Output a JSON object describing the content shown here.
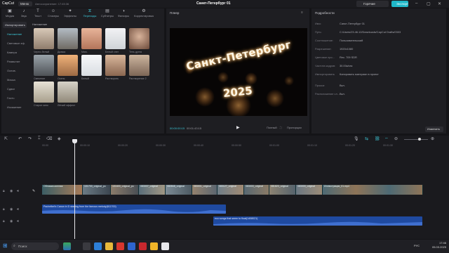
{
  "titlebar": {
    "app_name": "CapCut",
    "menu_label": "Меню",
    "autosave": "Автосохранение: 17:45:36",
    "project_title": "Санкт-Петербург 01",
    "hotkeys_label": "Горячие клавиши",
    "export_label": "Экспорт"
  },
  "toolbar": {
    "tools": [
      {
        "label": "Медиа",
        "icon": "media-icon",
        "active": false
      },
      {
        "label": "Звук",
        "icon": "audio-icon",
        "active": false
      },
      {
        "label": "Текст",
        "icon": "text-icon",
        "active": false
      },
      {
        "label": "Стикеры",
        "icon": "sticker-icon",
        "active": false
      },
      {
        "label": "Эффекты",
        "icon": "effects-icon",
        "active": false
      },
      {
        "label": "Переходы",
        "icon": "transitions-icon",
        "active": true
      },
      {
        "label": "Субтитры",
        "icon": "subtitles-icon",
        "active": false
      },
      {
        "label": "Фильтры",
        "icon": "filters-icon",
        "active": false
      },
      {
        "label": "Корректировка",
        "icon": "adjust-icon",
        "active": false
      }
    ]
  },
  "media": {
    "import_label": "Импортировать",
    "section_label": "Наложение",
    "categories": [
      "Наложение",
      "Световые эф.",
      "Камера",
      "Размытие",
      "Основ.",
      "Маска",
      "Сдвиг",
      "Глитч",
      "Искажение"
    ],
    "active_category": "Наложение",
    "thumbs": [
      {
        "caption": "Черно-белый"
      },
      {
        "caption": "Дымка"
      },
      {
        "caption": "Мягк."
      },
      {
        "caption": "Белый снег"
      },
      {
        "caption": "Тень дуэта"
      },
      {
        "caption": "Свечение"
      },
      {
        "caption": "Осень"
      },
      {
        "caption": "Белый"
      },
      {
        "caption": "Растворить"
      },
      {
        "caption": "Растворение 2"
      },
      {
        "caption": "Старое кино"
      },
      {
        "caption": "Лёгкий эффект"
      }
    ]
  },
  "player": {
    "title": "Плеер",
    "overlay_line1": "Санкт-Петербург",
    "overlay_line2": "2025",
    "timecode_current": "00:00:00:15",
    "timecode_total": "00:01:43:15",
    "btn_full": "Полный",
    "btn_ratio": "Пропорции"
  },
  "details": {
    "title": "Подробности",
    "rows": [
      {
        "label": "Имя:",
        "value": "Санкт-Петербург 01"
      },
      {
        "label": "Путь:",
        "value": "C:/Users/23.46.12/Downloads/CapCut Drafts/0303"
      },
      {
        "label": "Соотношение:",
        "value": "Пользовательский"
      },
      {
        "label": "Разрешение:",
        "value": "1920x1080"
      },
      {
        "label": "Цветовое про...",
        "value": "Rec. 709 SDR"
      },
      {
        "label": "Частота кадров:",
        "value": "30.00к/сек"
      },
      {
        "label": "Импортировать",
        "value": "Копировать материал в проект"
      },
      {
        "label": "Прокси:",
        "value": "Вкл."
      },
      {
        "label": "Расположение сл...",
        "value": "Вкл."
      }
    ],
    "modify_label": "Изменить"
  },
  "timeline": {
    "ruler_ticks": [
      "00:00",
      "00:00:10",
      "00:00:20",
      "00:00:30",
      "00:00:40",
      "00:00:50",
      "00:01:00",
      "00:01:10",
      "00:01:20",
      "00:01:30"
    ],
    "video_clips": [
      {
        "name": "Обложка-коллаж",
        "meta": "00:00:05:00"
      },
      {
        "name": "101700_original_po"
      },
      {
        "name": "101600_original_po"
      },
      {
        "name": "083007_original"
      },
      {
        "name": "082848_original"
      },
      {
        "name": "083001_original"
      },
      {
        "name": "083127_original"
      },
      {
        "name": "083000_original"
      },
      {
        "name": "081820_original"
      },
      {
        "name": "083000_original"
      },
      {
        "name": "Иллюстрация_01.mp4"
      }
    ],
    "audio1_name": "Pachelbel's Canon in D starting from the famous melody(611700)",
    "audio2_name": "eco songs that seem to float(1408021)"
  },
  "taskbar": {
    "search_placeholder": "Поиск",
    "lang": "РУС",
    "time": "17:46",
    "date": "05.03.2025"
  },
  "colors": {
    "accent": "#1fb8c9",
    "audio_clip": "#1f4aa0",
    "video_track": "#2c4a52"
  }
}
